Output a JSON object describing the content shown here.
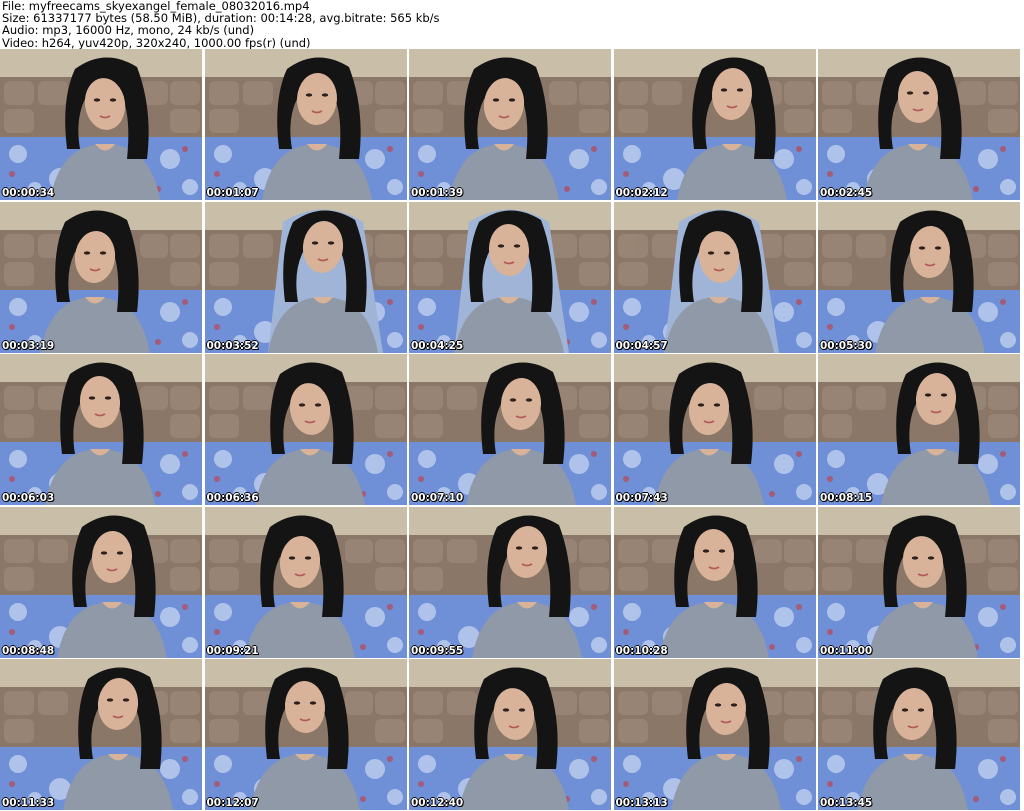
{
  "header": {
    "file_line": "File: myfreecams_skyexangel_female_08032016.mp4",
    "size_line": "Size: 61337177 bytes (58.50 MiB), duration: 00:14:28, avg.bitrate: 565 kb/s",
    "audio_line": "Audio: mp3, 16000 Hz, mono, 24 kb/s (und)",
    "video_line": "Video: h264, yuv420p, 320x240, 1000.00 fps(r) (und)"
  },
  "colors": {
    "wall": "#c9bfa8",
    "headboard": "#8a7767",
    "blanket": "#6f8fd6",
    "hair": "#141414",
    "skin": "#d9b29a",
    "shirt": "#8f99a8"
  },
  "thumbnails": [
    {
      "timestamp": "00:00:34"
    },
    {
      "timestamp": "00:01:07"
    },
    {
      "timestamp": "00:01:39"
    },
    {
      "timestamp": "00:02:12"
    },
    {
      "timestamp": "00:02:45"
    },
    {
      "timestamp": "00:03:19"
    },
    {
      "timestamp": "00:03:52"
    },
    {
      "timestamp": "00:04:25"
    },
    {
      "timestamp": "00:04:57"
    },
    {
      "timestamp": "00:05:30"
    },
    {
      "timestamp": "00:06:03"
    },
    {
      "timestamp": "00:06:36"
    },
    {
      "timestamp": "00:07:10"
    },
    {
      "timestamp": "00:07:43"
    },
    {
      "timestamp": "00:08:15"
    },
    {
      "timestamp": "00:08:48"
    },
    {
      "timestamp": "00:09:21"
    },
    {
      "timestamp": "00:09:55"
    },
    {
      "timestamp": "00:10:28"
    },
    {
      "timestamp": "00:11:00"
    },
    {
      "timestamp": "00:11:33"
    },
    {
      "timestamp": "00:12:07"
    },
    {
      "timestamp": "00:12:40"
    },
    {
      "timestamp": "00:13:13"
    },
    {
      "timestamp": "00:13:45"
    }
  ]
}
